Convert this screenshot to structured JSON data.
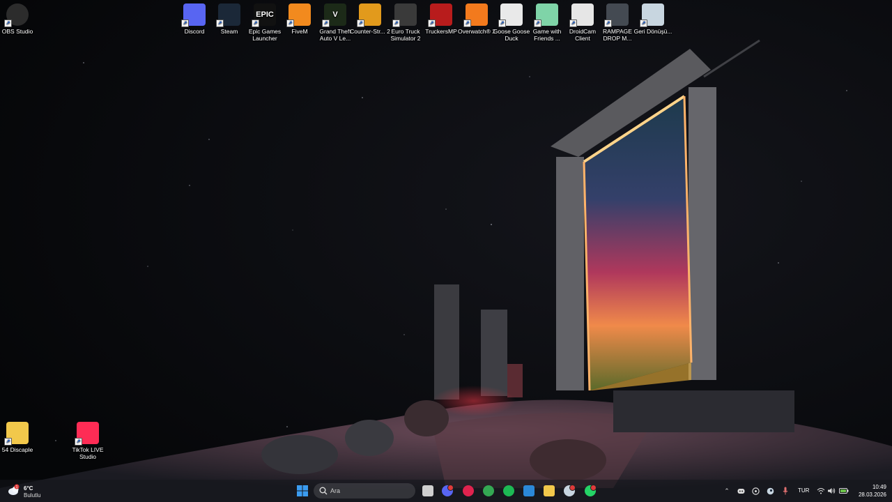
{
  "desktop": {
    "top_icons": [
      {
        "label": "OBS Studio",
        "icon": "obs-icon",
        "color": "#2c2c2c"
      },
      {
        "label": "Discord",
        "icon": "discord-icon",
        "color": "#5865f2"
      },
      {
        "label": "Steam",
        "icon": "steam-icon",
        "color": "#1b2838"
      },
      {
        "label": "Epic Games Launcher",
        "icon": "epic-games-icon",
        "color": "#111111",
        "glyph_text": "EPIC"
      },
      {
        "label": "FiveM",
        "icon": "fivem-icon",
        "color": "#f28a1e"
      },
      {
        "label": "Grand Theft Auto V Le...",
        "icon": "gta-v-icon",
        "color": "#1c2a18",
        "glyph_text": "V"
      },
      {
        "label": "Counter-Str... 2",
        "icon": "counter-strike-icon",
        "color": "#e29a1c"
      },
      {
        "label": "Euro Truck Simulator 2",
        "icon": "euro-truck-icon",
        "color": "#3a3a3a"
      },
      {
        "label": "TruckersMP",
        "icon": "truckersmp-icon",
        "color": "#b81c1c"
      },
      {
        "label": "Overwatch® 2",
        "icon": "overwatch-icon",
        "color": "#f37a1d"
      },
      {
        "label": "Goose Goose Duck",
        "icon": "goose-goose-duck-icon",
        "color": "#e9e9e9"
      },
      {
        "label": "Game with Friends ...",
        "icon": "game-with-friends-icon",
        "color": "#7fd4a8"
      },
      {
        "label": "DroidCam Client",
        "icon": "droidcam-icon",
        "color": "#e6e6e6"
      },
      {
        "label": "RAMPAGE DROP M...",
        "icon": "rampage-drop-icon",
        "color": "#444a52"
      },
      {
        "label": "Geri Dönüşü...",
        "icon": "recycle-bin-icon",
        "color": "#c8d6e0"
      }
    ],
    "bottom_icons": [
      {
        "label": "54 Discaple",
        "icon": "folder-icon",
        "color": "#f2c84b"
      },
      {
        "label": "TikTok LIVE Studio",
        "icon": "tiktok-live-studio-icon",
        "color": "#fe2c55"
      }
    ]
  },
  "taskbar": {
    "weather": {
      "temp": "6°C",
      "desc": "Bulutlu",
      "icon": "cloud-icon",
      "badge": "1"
    },
    "search_placeholder": "Ara",
    "pinned": [
      {
        "name": "start-button",
        "icon": "windows-icon",
        "color": "#3b9cf0"
      },
      {
        "name": "file-explorer-taskview",
        "icon": "taskview-icon",
        "color": "#cfcfcf"
      },
      {
        "name": "discord-taskbar",
        "icon": "discord-icon",
        "color": "#5865f2",
        "badge": true
      },
      {
        "name": "opera-gx-taskbar",
        "icon": "opera-gx-icon",
        "color": "#e0234e"
      },
      {
        "name": "chrome-taskbar",
        "icon": "chrome-icon",
        "color": "#34a853"
      },
      {
        "name": "spotify-taskbar",
        "icon": "spotify-icon",
        "color": "#1db954"
      },
      {
        "name": "store-taskbar",
        "icon": "store-icon",
        "color": "#2b88d8"
      },
      {
        "name": "files-taskbar",
        "icon": "folder-icon",
        "color": "#f2c84b"
      },
      {
        "name": "steam-taskbar",
        "icon": "steam-icon",
        "color": "#c7d5e0",
        "badge": true
      },
      {
        "name": "whatsapp-taskbar",
        "icon": "whatsapp-icon",
        "color": "#25d366",
        "badge": true
      }
    ],
    "language": "TUR",
    "time": "10:49",
    "date": "28.03.2026"
  }
}
